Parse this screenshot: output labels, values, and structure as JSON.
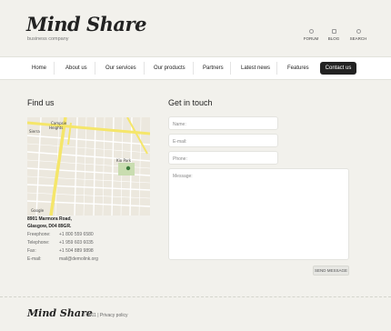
{
  "header": {
    "logo": "Mind Share",
    "tagline": "business company",
    "quick_links": [
      {
        "label": "FORUM",
        "icon": "chat-icon"
      },
      {
        "label": "BLOG",
        "icon": "pen-icon"
      },
      {
        "label": "SEARCH",
        "icon": "search-icon"
      }
    ]
  },
  "nav": {
    "items": [
      "Home",
      "About us",
      "Our services",
      "Our products",
      "Partners",
      "Latest news",
      "Features"
    ],
    "active": "Contact us"
  },
  "find_us": {
    "title": "Find us",
    "address_line1": "8901 Marmora Road,",
    "address_line2": "Glasgow, D04 89GR.",
    "rows": [
      {
        "label": "Freephone:",
        "value": "+1 800 559 6580"
      },
      {
        "label": "Telephone:",
        "value": "+1 959 603 6035"
      },
      {
        "label": "Fax:",
        "value": "+1 504 889 9898"
      },
      {
        "label": "E-mail:",
        "value": "mail@demolink.org"
      }
    ]
  },
  "get_in_touch": {
    "title": "Get in touch",
    "name_placeholder": "Name:",
    "email_placeholder": "E-mail:",
    "phone_placeholder": "Phone:",
    "message_placeholder": "Message:",
    "send_label": "SEND MESSAGE"
  },
  "footer": {
    "logo": "Mind Share",
    "copyright": "© 2011 |",
    "privacy": "Privacy policy"
  },
  "colors": {
    "background": "#f2f1ec",
    "nav_active": "#222222",
    "map_road": "#f5e66a",
    "map_park": "#c9ddb0"
  }
}
